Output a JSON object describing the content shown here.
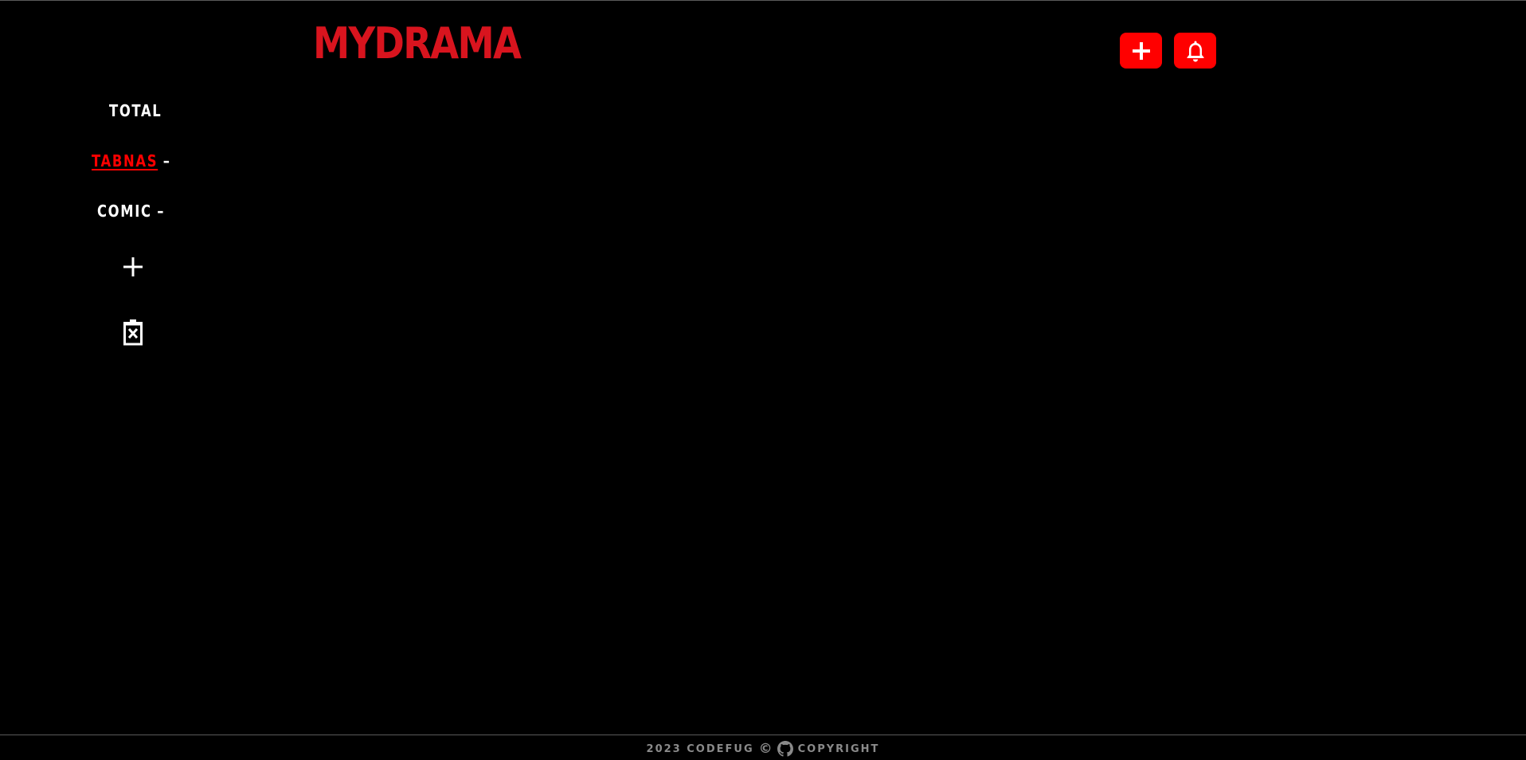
{
  "header": {
    "logo": "MYDRAMA",
    "add_button_icon": "plus-icon",
    "notification_button_icon": "bell-icon",
    "accent_color": "#ff0000"
  },
  "sidebar": {
    "items": [
      {
        "label": "TOTAL",
        "suffix": ""
      },
      {
        "label": "TABNAS",
        "suffix": "–",
        "active": true
      },
      {
        "label": "COMIC",
        "suffix": "–"
      }
    ],
    "add_icon": "plus-icon",
    "delete_icon": "trash-x-icon"
  },
  "footer": {
    "year_author": "2023 CODEFUG",
    "copyright_symbol": "©",
    "github_icon": "github-icon",
    "copyright_text": "COPYRIGHT"
  }
}
